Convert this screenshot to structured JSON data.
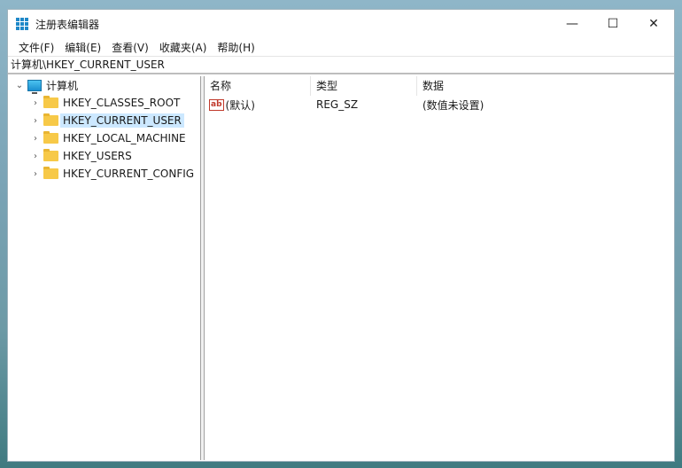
{
  "window": {
    "title": "注册表编辑器",
    "minimize": "—",
    "maximize": "☐",
    "close": "✕"
  },
  "menu": [
    "文件(F)",
    "编辑(E)",
    "查看(V)",
    "收藏夹(A)",
    "帮助(H)"
  ],
  "address": "计算机\\HKEY_CURRENT_USER",
  "tree": {
    "root": "计算机",
    "items": [
      "HKEY_CLASSES_ROOT",
      "HKEY_CURRENT_USER",
      "HKEY_LOCAL_MACHINE",
      "HKEY_USERS",
      "HKEY_CURRENT_CONFIG"
    ],
    "selected": "HKEY_CURRENT_USER"
  },
  "list": {
    "columns": [
      "名称",
      "类型",
      "数据"
    ],
    "rows": [
      {
        "name": "(默认)",
        "type": "REG_SZ",
        "data": "(数值未设置)",
        "icon": "ab"
      }
    ]
  }
}
